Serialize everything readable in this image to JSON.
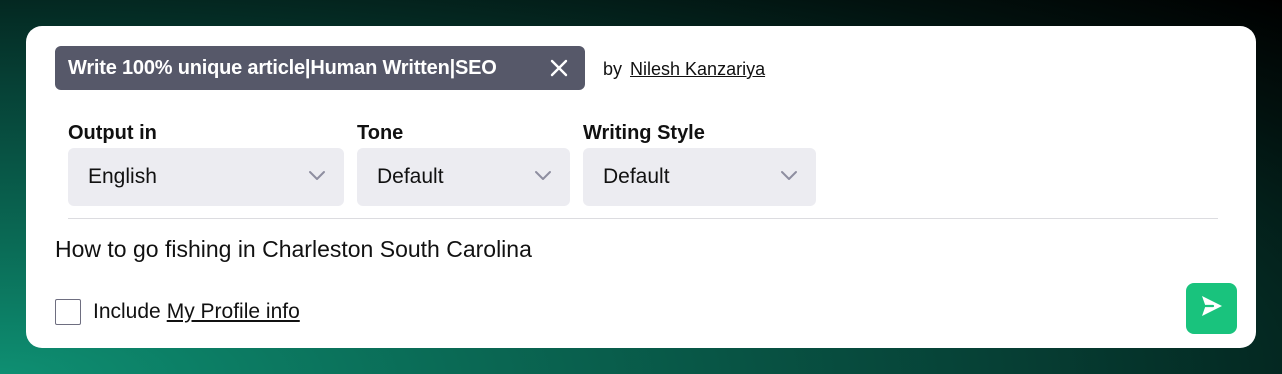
{
  "prompt": {
    "title": "Write 100% unique article|Human Written|SEO",
    "close_icon": "close-icon",
    "by_label": "by",
    "author": "Nilesh Kanzariya"
  },
  "fields": [
    {
      "label": "Output in",
      "value": "English",
      "icon": "chevron-down-icon"
    },
    {
      "label": "Tone",
      "value": "Default",
      "icon": "chevron-down-icon"
    },
    {
      "label": "Writing Style",
      "value": "Default",
      "icon": "chevron-down-icon"
    }
  ],
  "input": {
    "value": "How to go fishing in Charleston South Carolina"
  },
  "profile_option": {
    "checked": false,
    "label": "Include",
    "link": "My Profile info"
  },
  "send": {
    "icon": "send-icon",
    "color": "#19c37d"
  },
  "colors": {
    "chip_background": "#565869",
    "select_background": "#ececf1",
    "accent": "#19c37d"
  }
}
